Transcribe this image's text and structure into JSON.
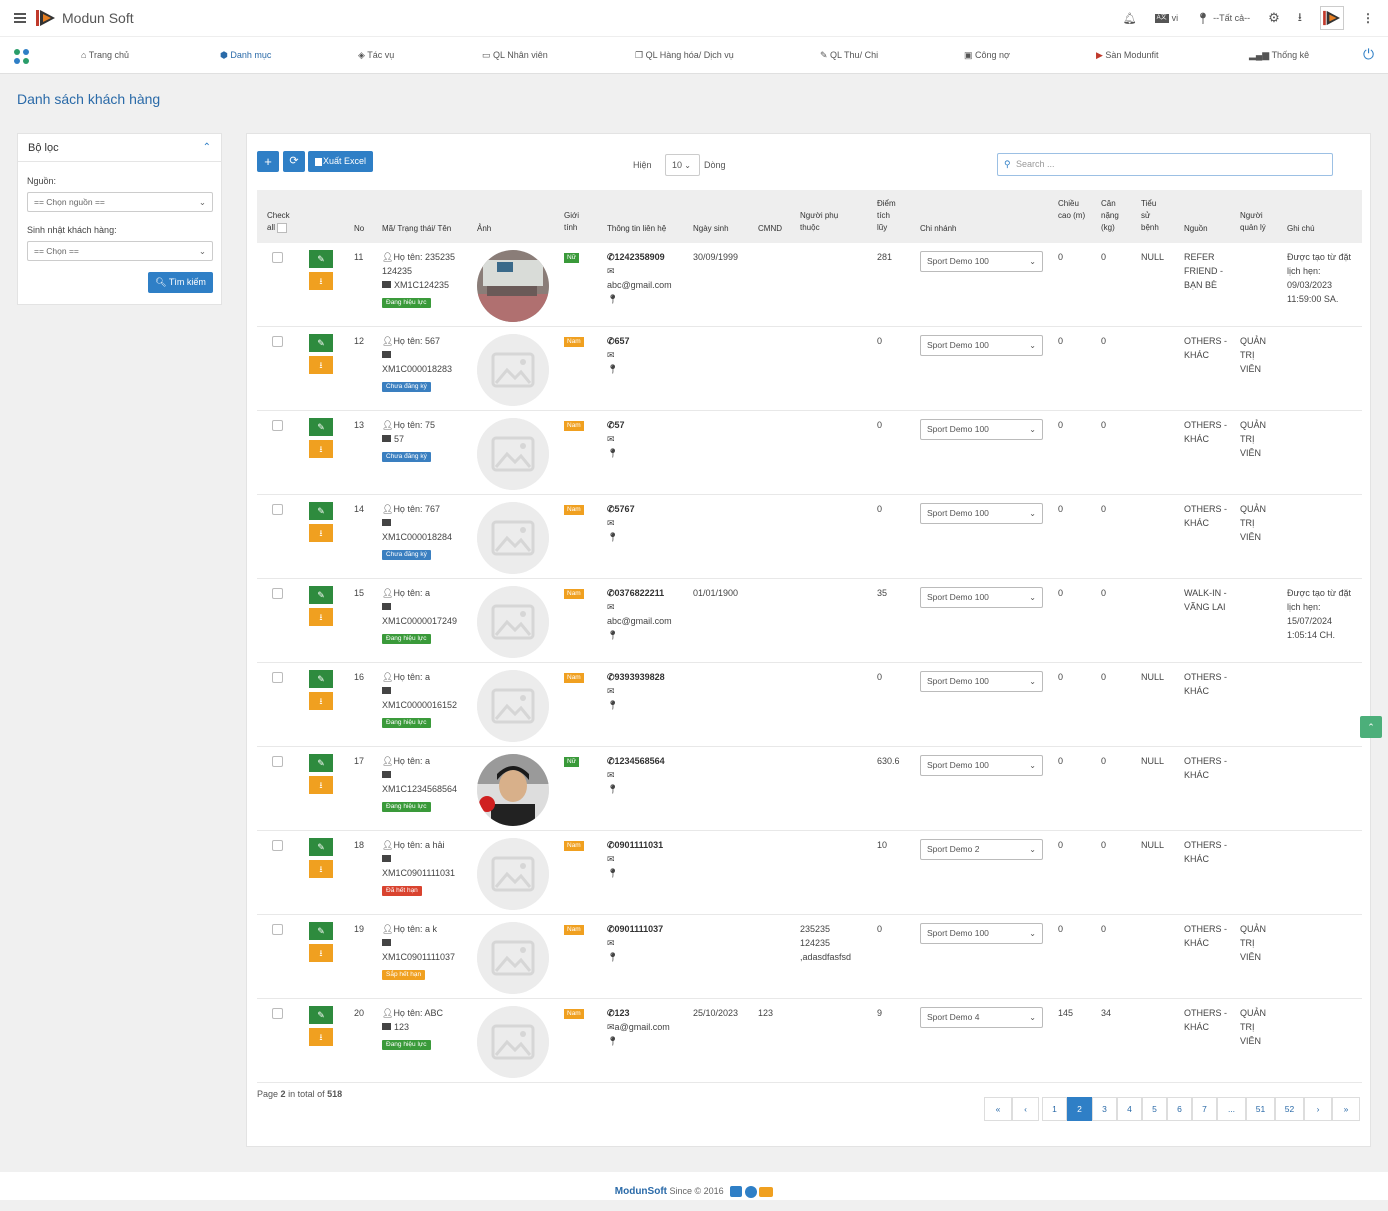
{
  "app": {
    "title": "Modun Soft"
  },
  "topbar": {
    "lang": "vi",
    "location": "--Tất cả--"
  },
  "nav": {
    "items": [
      {
        "icon": "home-icon",
        "label": "Trang chủ"
      },
      {
        "icon": "cube-icon",
        "label": "Danh mục"
      },
      {
        "icon": "tag-icon",
        "label": "Tác vụ"
      },
      {
        "icon": "monitor-icon",
        "label": "QL Nhân viên"
      },
      {
        "icon": "copy-icon",
        "label": "QL Hàng hóa/ Dịch vụ"
      },
      {
        "icon": "edit-icon",
        "label": "QL Thu/ Chi"
      },
      {
        "icon": "money-icon",
        "label": "Công nợ"
      },
      {
        "icon": "modunfit-logo-icon",
        "label": "Sàn Modunfit"
      },
      {
        "icon": "bar-chart-icon",
        "label": "Thống kê"
      }
    ]
  },
  "page": {
    "title": "Danh sách khách hàng"
  },
  "filter": {
    "title": "Bộ lọc",
    "source_label": "Nguồn:",
    "source_value": "== Chọn nguồn ==",
    "birthday_label": "Sinh nhật khách hàng:",
    "birthday_value": "== Chọn ==",
    "search_button": "Tìm kiếm"
  },
  "toolbar": {
    "add": "+",
    "refresh": "⟳",
    "export": "Xuất Excel",
    "show_label": "Hiện",
    "show_value": "10",
    "rows_label": "Dòng",
    "search_placeholder": "Search ..."
  },
  "table": {
    "headers": {
      "check": "Check all",
      "no": "No",
      "code": "Mã/ Trạng thái/ Tên",
      "photo": "Ảnh",
      "gender": "Giới tính",
      "contact": "Thông tin liên hệ",
      "dob": "Ngày sinh",
      "cmnd": "CMND",
      "dependent": "Người phụ thuộc",
      "points": "Điểm tích lũy",
      "branch": "Chi nhánh",
      "height": "Chiều cao (m)",
      "weight": "Cân nặng (kg)",
      "history": "Tiểu sử bệnh",
      "source": "Nguồn",
      "manager": "Người quản lý",
      "note": "Ghi chú"
    },
    "rows": [
      {
        "no": "11",
        "name": "Họ tên: 235235 124235",
        "code": "XM1C124235",
        "status": "Đang hiệu lực",
        "status_color": "#3a9a3a",
        "has_photo": true,
        "photo": "gym",
        "gender": "Nữ",
        "gender_color": "#3a9a3a",
        "phone": "1242358909",
        "email": "abc@gmail.com",
        "dob": "30/09/1999",
        "cmnd": "",
        "dependent": "",
        "points": "281",
        "branch": "Sport Demo 100",
        "height": "0",
        "weight": "0",
        "history": "NULL",
        "source": "REFER FRIEND - BẠN BÈ",
        "manager": "",
        "note": "Được tạo từ đặt lịch hẹn: 09/03/2023 11:59:00 SA."
      },
      {
        "no": "12",
        "name": "Họ tên: 567",
        "code": "XM1C000018283",
        "status": "Chưa đăng ký",
        "status_color": "#3a7fc0",
        "has_photo": false,
        "gender": "Nam",
        "gender_color": "#f0a020",
        "phone": "657",
        "email": "",
        "dob": "",
        "cmnd": "",
        "dependent": "",
        "points": "0",
        "branch": "Sport Demo 100",
        "height": "0",
        "weight": "0",
        "history": "",
        "source": "OTHERS - KHÁC",
        "manager": "QUẢN TRỊ VIÊN",
        "note": ""
      },
      {
        "no": "13",
        "name": "Họ tên: 75",
        "code": "57",
        "status": "Chưa đăng ký",
        "status_color": "#3a7fc0",
        "has_photo": false,
        "gender": "Nam",
        "gender_color": "#f0a020",
        "phone": "57",
        "email": "",
        "dob": "",
        "cmnd": "",
        "dependent": "",
        "points": "0",
        "branch": "Sport Demo 100",
        "height": "0",
        "weight": "0",
        "history": "",
        "source": "OTHERS - KHÁC",
        "manager": "QUẢN TRỊ VIÊN",
        "note": ""
      },
      {
        "no": "14",
        "name": "Họ tên: 767",
        "code": "XM1C000018284",
        "status": "Chưa đăng ký",
        "status_color": "#3a7fc0",
        "has_photo": false,
        "gender": "Nam",
        "gender_color": "#f0a020",
        "phone": "5767",
        "email": "",
        "dob": "",
        "cmnd": "",
        "dependent": "",
        "points": "0",
        "branch": "Sport Demo 100",
        "height": "0",
        "weight": "0",
        "history": "",
        "source": "OTHERS - KHÁC",
        "manager": "QUẢN TRỊ VIÊN",
        "note": ""
      },
      {
        "no": "15",
        "name": "Họ tên: a",
        "code": "XM1C0000017249",
        "status": "Đang hiệu lực",
        "status_color": "#3a9a3a",
        "has_photo": false,
        "gender": "Nam",
        "gender_color": "#f0a020",
        "phone": "0376822211",
        "email": "abc@gmail.com",
        "dob": "01/01/1900",
        "cmnd": "",
        "dependent": "",
        "points": "35",
        "branch": "Sport Demo 100",
        "height": "0",
        "weight": "0",
        "history": "",
        "source": "WALK-IN - VÃNG LAI",
        "manager": "",
        "note": "Được tạo từ đặt lịch hẹn: 15/07/2024 1:05:14 CH."
      },
      {
        "no": "16",
        "name": "Họ tên: a",
        "code": "XM1C0000016152",
        "status": "Đang hiệu lực",
        "status_color": "#3a9a3a",
        "has_photo": false,
        "gender": "Nam",
        "gender_color": "#f0a020",
        "phone": "9393939828",
        "email": "",
        "dob": "",
        "cmnd": "",
        "dependent": "",
        "points": "0",
        "branch": "Sport Demo 100",
        "height": "0",
        "weight": "0",
        "history": "NULL",
        "source": "OTHERS - KHÁC",
        "manager": "",
        "note": ""
      },
      {
        "no": "17",
        "name": "Họ tên: a",
        "code": "XM1C1234568564",
        "status": "Đang hiệu lực",
        "status_color": "#3a9a3a",
        "has_photo": true,
        "photo": "person",
        "gender": "Nữ",
        "gender_color": "#3a9a3a",
        "phone": "1234568564",
        "email": "",
        "dob": "",
        "cmnd": "",
        "dependent": "",
        "points": "630.6",
        "branch": "Sport Demo 100",
        "height": "0",
        "weight": "0",
        "history": "NULL",
        "source": "OTHERS - KHÁC",
        "manager": "",
        "note": ""
      },
      {
        "no": "18",
        "name": "Họ tên: a hải",
        "code": "XM1C0901111031",
        "status": "Đã hết hạn",
        "status_color": "#d9432f",
        "has_photo": false,
        "gender": "Nam",
        "gender_color": "#f0a020",
        "phone": "0901111031",
        "email": "",
        "dob": "",
        "cmnd": "",
        "dependent": "",
        "points": "10",
        "branch": "Sport Demo 2",
        "height": "0",
        "weight": "0",
        "history": "NULL",
        "source": "OTHERS - KHÁC",
        "manager": "",
        "note": ""
      },
      {
        "no": "19",
        "name": "Họ tên: a k",
        "code": "XM1C0901111037",
        "status": "Sắp hết hạn",
        "status_color": "#f0a020",
        "has_photo": false,
        "gender": "Nam",
        "gender_color": "#f0a020",
        "phone": "0901111037",
        "email": "",
        "dob": "",
        "cmnd": "",
        "dependent": "235235 124235 ,adasdfasfsd",
        "points": "0",
        "branch": "Sport Demo 100",
        "height": "0",
        "weight": "0",
        "history": "",
        "source": "OTHERS - KHÁC",
        "manager": "QUẢN TRỊ VIÊN",
        "note": ""
      },
      {
        "no": "20",
        "name": "Họ tên: ABC",
        "code": "123",
        "status": "Đang hiệu lực",
        "status_color": "#3a9a3a",
        "has_photo": false,
        "gender": "Nam",
        "gender_color": "#f0a020",
        "phone": "123",
        "email": "a@gmail.com",
        "dob": "25/10/2023",
        "cmnd": "123",
        "dependent": "",
        "points": "9",
        "branch": "Sport Demo 4",
        "height": "145",
        "weight": "34",
        "history": "",
        "source": "OTHERS - KHÁC",
        "manager": "QUẢN TRỊ VIÊN",
        "note": ""
      }
    ]
  },
  "pagination": {
    "info_prefix": "Page",
    "page": "2",
    "info_middle": "in total of",
    "total": "518",
    "pages": [
      "1",
      "2",
      "3",
      "4",
      "5",
      "6",
      "7",
      "...",
      "51",
      "52"
    ],
    "current": "2"
  },
  "footer": {
    "brand": "ModunSoft",
    "since": "Since © 2016"
  }
}
